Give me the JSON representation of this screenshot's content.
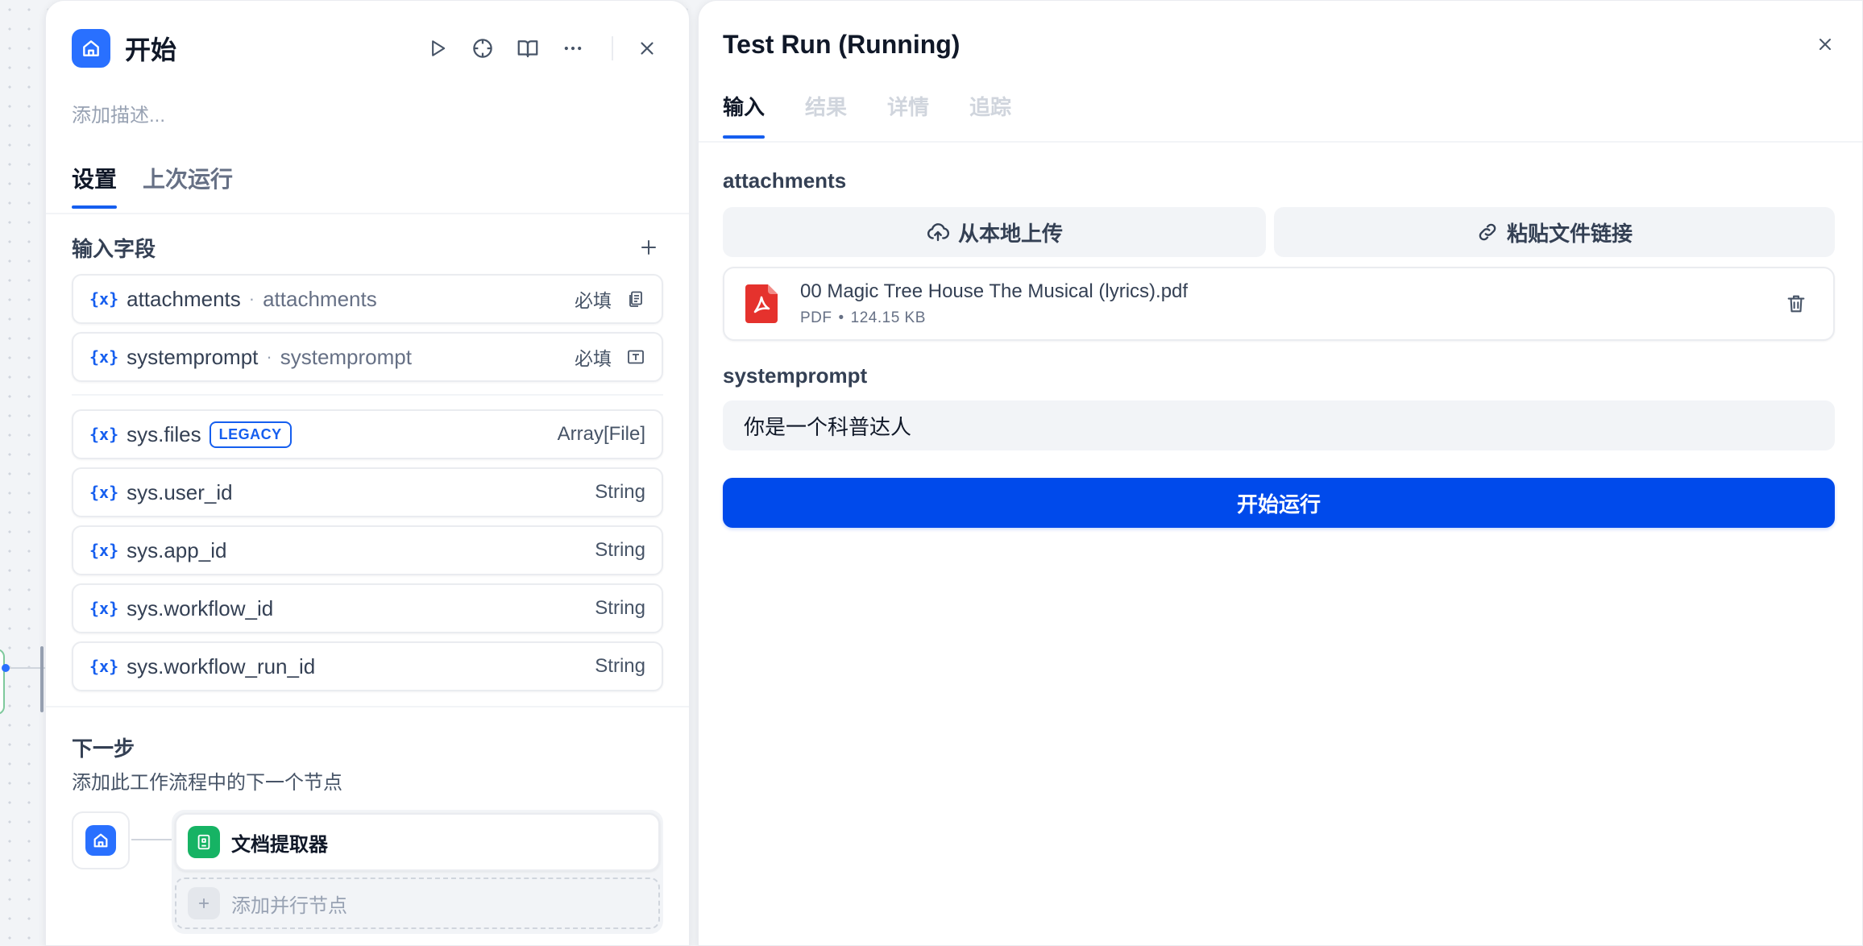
{
  "node": {
    "title": "开始",
    "description_placeholder": "添加描述...",
    "tabs": [
      {
        "label": "设置"
      },
      {
        "label": "上次运行"
      }
    ],
    "input_fields": {
      "title": "输入字段",
      "items": [
        {
          "name": "attachments",
          "label": "attachments",
          "required": "必填",
          "type_icon": "file-list-icon"
        },
        {
          "name": "systemprompt",
          "label": "systemprompt",
          "required": "必填",
          "type_icon": "text-input-icon"
        }
      ]
    },
    "system_vars": [
      {
        "name": "sys.files",
        "badge": "LEGACY",
        "type": "Array[File]"
      },
      {
        "name": "sys.user_id",
        "type": "String"
      },
      {
        "name": "sys.app_id",
        "type": "String"
      },
      {
        "name": "sys.workflow_id",
        "type": "String"
      },
      {
        "name": "sys.workflow_run_id",
        "type": "String"
      }
    ],
    "var_icon_text": "{x}",
    "next_step": {
      "title": "下一步",
      "description": "添加此工作流程中的下一个节点",
      "next_node": "文档提取器",
      "add_parallel": "添加并行节点"
    }
  },
  "test_run": {
    "title": "Test Run (Running)",
    "tabs": [
      {
        "label": "输入"
      },
      {
        "label": "结果"
      },
      {
        "label": "详情"
      },
      {
        "label": "追踪"
      }
    ],
    "attachments": {
      "label": "attachments",
      "upload_local": "从本地上传",
      "paste_link": "粘贴文件链接",
      "file": {
        "name": "00 Magic Tree House The Musical (lyrics).pdf",
        "type": "PDF",
        "size": "124.15 KB"
      }
    },
    "systemprompt": {
      "label": "systemprompt",
      "value": "你是一个科普达人"
    },
    "run_button": "开始运行"
  },
  "colors": {
    "primary": "#155eef",
    "run_button": "#004aeb",
    "node_icon": "#2970ff",
    "extractor_icon": "#16b364",
    "pdf": "#e5322d"
  }
}
